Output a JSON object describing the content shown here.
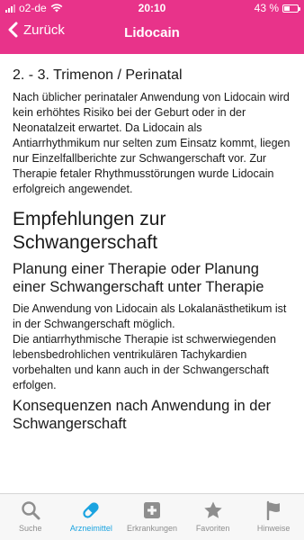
{
  "status_bar": {
    "carrier": "o2-de",
    "time": "20:10",
    "battery": "43 %",
    "battery_level": 0.43
  },
  "nav": {
    "back_label": "Zurück",
    "title": "Lidocain"
  },
  "content": {
    "section_trimenon_title": "2. - 3. Trimenon / Perinatal",
    "section_trimenon_text": "Nach üblicher perinataler Anwendung von Lidocain wird kein erhöhtes Risiko bei der Geburt oder in der Neonatalzeit erwartet. Da Lidocain als Antiarrhythmikum nur selten zum Einsatz kommt, liegen nur Einzelfallberichte zur Schwangerschaft vor. Zur Therapie fetaler Rhythmusstörungen wurde Lidocain erfolgreich angewendet.",
    "recommendations_heading": "Empfehlungen zur Schwangerschaft",
    "planning_heading": "Planung einer Therapie oder Planung einer Schwangerschaft unter Therapie",
    "planning_text_1": "Die Anwendung von Lidocain als Lokalanästhetikum ist in der Schwangerschaft möglich.",
    "planning_text_2": "Die antiarrhythmische Therapie ist schwerwiegenden lebensbedrohlichen ventrikulären Tachykardien vorbehalten und kann auch in der Schwangerschaft erfolgen.",
    "consequences_heading": "Konsequenzen nach Anwendung in der Schwangerschaft"
  },
  "tabs": [
    {
      "label": "Suche",
      "icon": "search-icon",
      "active": false
    },
    {
      "label": "Arzneimittel",
      "icon": "pill-icon",
      "active": true
    },
    {
      "label": "Erkrankungen",
      "icon": "medical-cross-icon",
      "active": false
    },
    {
      "label": "Favoriten",
      "icon": "star-icon",
      "active": false
    },
    {
      "label": "Hinweise",
      "icon": "flag-icon",
      "active": false
    }
  ],
  "colors": {
    "brand": "#e8338a",
    "tab_active": "#1aa3e0",
    "tab_inactive": "#8e8e8e"
  }
}
